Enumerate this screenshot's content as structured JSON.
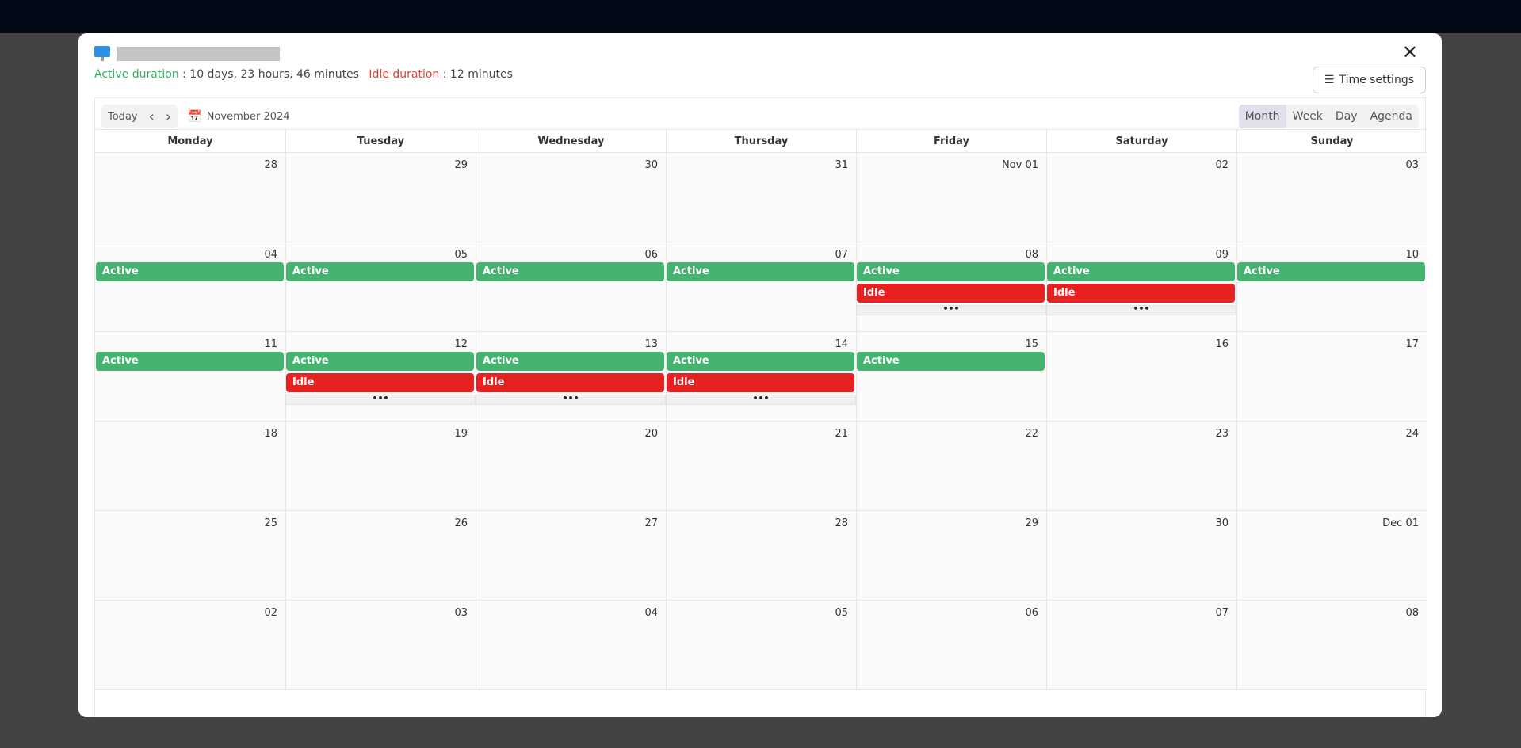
{
  "modal": {
    "active_label": "Active duration",
    "active_value": " : 10 days, 23 hours, 46 minutes",
    "idle_label": "Idle duration",
    "idle_value": " : 12 minutes",
    "close": "✕",
    "time_settings": "Time settings"
  },
  "toolbar": {
    "today": "Today",
    "prev": "‹",
    "next": "›",
    "month": "November 2024",
    "views": [
      "Month",
      "Week",
      "Day",
      "Agenda"
    ],
    "active_view": "Month"
  },
  "weekdays": [
    "Monday",
    "Tuesday",
    "Wednesday",
    "Thursday",
    "Friday",
    "Saturday",
    "Sunday"
  ],
  "colors": {
    "active": "#45b36f",
    "idle": "#e52121"
  },
  "more_label": "•••",
  "weeks": [
    [
      {
        "d": "28"
      },
      {
        "d": "29"
      },
      {
        "d": "30"
      },
      {
        "d": "31"
      },
      {
        "d": "Nov 01"
      },
      {
        "d": "02"
      },
      {
        "d": "03"
      }
    ],
    [
      {
        "d": "04",
        "ev": [
          "Active"
        ]
      },
      {
        "d": "05",
        "ev": [
          "Active"
        ]
      },
      {
        "d": "06",
        "ev": [
          "Active"
        ]
      },
      {
        "d": "07",
        "ev": [
          "Active"
        ]
      },
      {
        "d": "08",
        "ev": [
          "Active",
          "Idle"
        ],
        "more": true
      },
      {
        "d": "09",
        "ev": [
          "Active",
          "Idle"
        ],
        "more": true
      },
      {
        "d": "10",
        "ev": [
          "Active"
        ]
      }
    ],
    [
      {
        "d": "11",
        "ev": [
          "Active"
        ]
      },
      {
        "d": "12",
        "ev": [
          "Active",
          "Idle"
        ],
        "more": true
      },
      {
        "d": "13",
        "ev": [
          "Active",
          "Idle"
        ],
        "more": true
      },
      {
        "d": "14",
        "ev": [
          "Active",
          "Idle"
        ],
        "more": true
      },
      {
        "d": "15",
        "ev": [
          "Active"
        ]
      },
      {
        "d": "16"
      },
      {
        "d": "17"
      }
    ],
    [
      {
        "d": "18"
      },
      {
        "d": "19"
      },
      {
        "d": "20"
      },
      {
        "d": "21"
      },
      {
        "d": "22"
      },
      {
        "d": "23"
      },
      {
        "d": "24"
      }
    ],
    [
      {
        "d": "25"
      },
      {
        "d": "26"
      },
      {
        "d": "27"
      },
      {
        "d": "28"
      },
      {
        "d": "29"
      },
      {
        "d": "30"
      },
      {
        "d": "Dec 01"
      }
    ],
    [
      {
        "d": "02"
      },
      {
        "d": "03"
      },
      {
        "d": "04"
      },
      {
        "d": "05"
      },
      {
        "d": "06"
      },
      {
        "d": "07"
      },
      {
        "d": "08"
      }
    ]
  ]
}
